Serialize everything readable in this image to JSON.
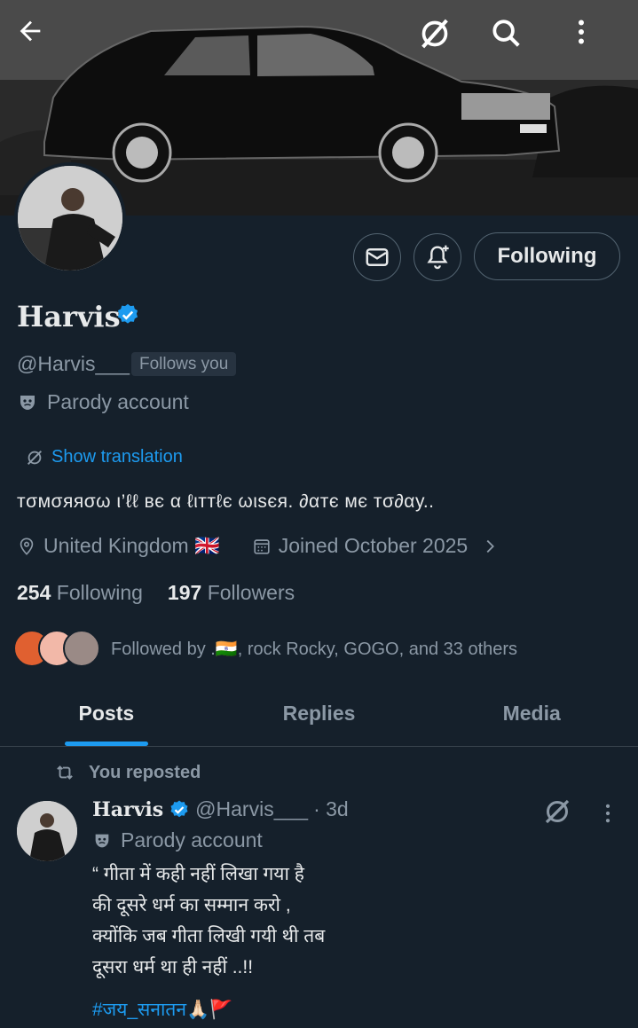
{
  "header": {
    "back_icon": "arrow-left-icon",
    "grok_icon": "grok-icon",
    "search_icon": "search-icon",
    "more_icon": "more-vertical-icon"
  },
  "profile": {
    "name": "Harvis",
    "handle": "@Harvis___",
    "follows_you": "Follows you",
    "parody_label": "Parody account",
    "show_translation": "Show translation",
    "bio": "тσмσяяσω ι’ℓℓ вє α ℓιттℓє ωιѕєя. ∂αтє мє тσ∂αу..",
    "location": "United Kingdom 🇬🇧",
    "joined": "Joined October 2025",
    "following_count": "254",
    "following_label": "Following",
    "followers_count": "197",
    "followers_label": "Followers",
    "followed_by": "Followed by .🇮🇳, rock Rocky, GOGO, and 33 others",
    "following_button": "Following"
  },
  "tabs": [
    {
      "label": "Posts",
      "active": true
    },
    {
      "label": "Replies",
      "active": false
    },
    {
      "label": "Media",
      "active": false
    }
  ],
  "post": {
    "repost_label": "You reposted",
    "name": "Harvis",
    "handle": "@Harvis___",
    "time": "· 3d",
    "parody_label": "Parody account",
    "lines": [
      "“ गीता में कही नहीं लिखा गया है",
      "की दूसरे धर्म का सम्मान करो ,",
      "क्योंकि जब गीता लिखी गयी थी तब",
      "दूसरा धर्म था ही नहीं ..!!"
    ],
    "hashtag": "#जय_सनातन🙏🏻🚩"
  },
  "colors": {
    "background": "#15202b",
    "accent": "#1d9bf0",
    "muted": "#8b98a5",
    "border": "#536471"
  }
}
